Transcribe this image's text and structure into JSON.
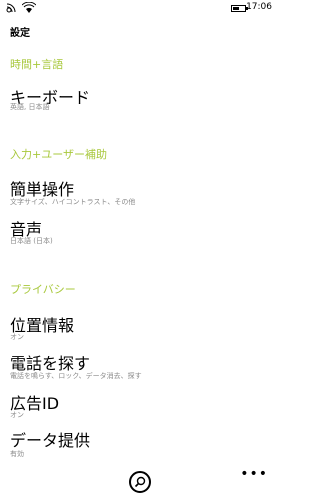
{
  "status": {
    "time": "17:06",
    "icons": [
      "signal-icon",
      "wifi-icon",
      "battery-icon"
    ]
  },
  "page": {
    "title": "設定"
  },
  "groups": [
    {
      "header": "時間+言語",
      "items": [
        {
          "title": "キーボード",
          "subtitle": "英語, 日本語"
        }
      ]
    },
    {
      "header": "入力+ユーザー補助",
      "items": [
        {
          "title": "簡単操作",
          "subtitle": "文字サイズ、ハイコントラスト、その他"
        },
        {
          "title": "音声",
          "subtitle": "日本語 (日本)"
        }
      ]
    },
    {
      "header": "プライバシー",
      "items": [
        {
          "title": "位置情報",
          "subtitle": "オン"
        },
        {
          "title": "電話を探す",
          "subtitle": "電話を鳴らす、ロック、データ消去、探す"
        },
        {
          "title": "広告ID",
          "subtitle": "オン"
        },
        {
          "title": "データ提供",
          "subtitle": "有効"
        }
      ]
    }
  ],
  "appbar": {
    "more_label": "•••",
    "icons": [
      "search-icon",
      "more-icon"
    ]
  }
}
